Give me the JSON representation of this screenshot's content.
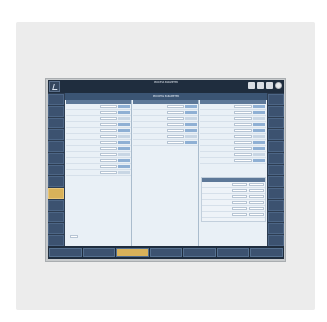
{
  "window": {
    "title": "PROCESS PARAMETER",
    "status": ""
  },
  "panel": {
    "title": "PROCESS PARAMETER"
  },
  "toolbar": {
    "icons": [
      "save-icon",
      "folder-icon",
      "print-icon",
      "help-icon"
    ]
  },
  "side_left": [
    {
      "label": ""
    },
    {
      "label": ""
    },
    {
      "label": ""
    },
    {
      "label": ""
    },
    {
      "label": ""
    },
    {
      "label": ""
    },
    {
      "label": ""
    },
    {
      "label": ""
    },
    {
      "label": "",
      "active": true
    },
    {
      "label": ""
    },
    {
      "label": ""
    },
    {
      "label": ""
    },
    {
      "label": ""
    }
  ],
  "side_right": [
    {
      "label": ""
    },
    {
      "label": ""
    },
    {
      "label": ""
    },
    {
      "label": ""
    },
    {
      "label": ""
    },
    {
      "label": ""
    },
    {
      "label": ""
    },
    {
      "label": ""
    },
    {
      "label": ""
    },
    {
      "label": ""
    },
    {
      "label": ""
    },
    {
      "label": ""
    },
    {
      "label": ""
    }
  ],
  "columns": [
    {
      "headers": [
        "",
        "",
        ""
      ],
      "rows": [
        {
          "label": "",
          "value": ""
        },
        {
          "label": "",
          "value": ""
        },
        {
          "label": "",
          "value": ""
        },
        {
          "label": "",
          "value": ""
        },
        {
          "label": "",
          "value": ""
        },
        {
          "label": "",
          "value": ""
        },
        {
          "label": "",
          "value": ""
        },
        {
          "label": "",
          "value": ""
        },
        {
          "label": "",
          "value": ""
        },
        {
          "label": "",
          "value": ""
        },
        {
          "label": "",
          "value": ""
        },
        {
          "label": "",
          "value": ""
        }
      ]
    },
    {
      "headers": [
        "",
        "",
        ""
      ],
      "rows": [
        {
          "label": "",
          "value": ""
        },
        {
          "label": "",
          "value": ""
        },
        {
          "label": "",
          "value": ""
        },
        {
          "label": "",
          "value": ""
        },
        {
          "label": "",
          "value": ""
        },
        {
          "label": "",
          "value": ""
        },
        {
          "label": "",
          "value": ""
        }
      ]
    },
    {
      "headers": [
        "",
        "",
        ""
      ],
      "rows": [
        {
          "label": "",
          "value": ""
        },
        {
          "label": "",
          "value": ""
        },
        {
          "label": "",
          "value": ""
        },
        {
          "label": "",
          "value": ""
        },
        {
          "label": "",
          "value": ""
        },
        {
          "label": "",
          "value": ""
        },
        {
          "label": "",
          "value": ""
        },
        {
          "label": "",
          "value": ""
        },
        {
          "label": "",
          "value": ""
        },
        {
          "label": "",
          "value": ""
        }
      ]
    }
  ],
  "subtable": {
    "headers": [
      "",
      "",
      ""
    ],
    "rows": [
      {
        "label": ""
      },
      {
        "label": ""
      },
      {
        "label": ""
      },
      {
        "label": ""
      },
      {
        "label": ""
      },
      {
        "label": ""
      }
    ]
  },
  "bottom_input": {
    "label": ""
  },
  "bottombar": [
    {
      "label": ""
    },
    {
      "label": ""
    },
    {
      "label": "",
      "active": true
    },
    {
      "label": ""
    },
    {
      "label": ""
    },
    {
      "label": ""
    },
    {
      "label": ""
    }
  ]
}
